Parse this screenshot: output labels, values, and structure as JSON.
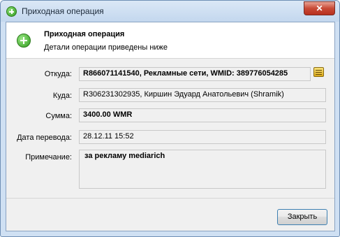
{
  "window": {
    "title": "Приходная операция",
    "close_symbol": "✕"
  },
  "header": {
    "title": "Приходная операция",
    "subtitle": "Детали операции приведены ниже",
    "icon": "add-circle-icon"
  },
  "fields": {
    "from_label": "Откуда:",
    "from_value": "R866071141540, Рекламные сети, WMID: 389776054285",
    "to_label": "Куда:",
    "to_value": "R306231302935, Киршин Эдуард Анатольевич (Shramik)",
    "amount_label": "Сумма:",
    "amount_value": "3400.00 WMR",
    "date_label": "Дата перевода:",
    "date_value": "28.12.11 15:52",
    "note_label": "Примечание:",
    "note_value": "за рекламу mediarich"
  },
  "buttons": {
    "close_label": "Закрыть"
  },
  "colors": {
    "accent_green": "#2f9a1c",
    "titlebar": "#cfe0f3",
    "close_red": "#c84a36"
  }
}
